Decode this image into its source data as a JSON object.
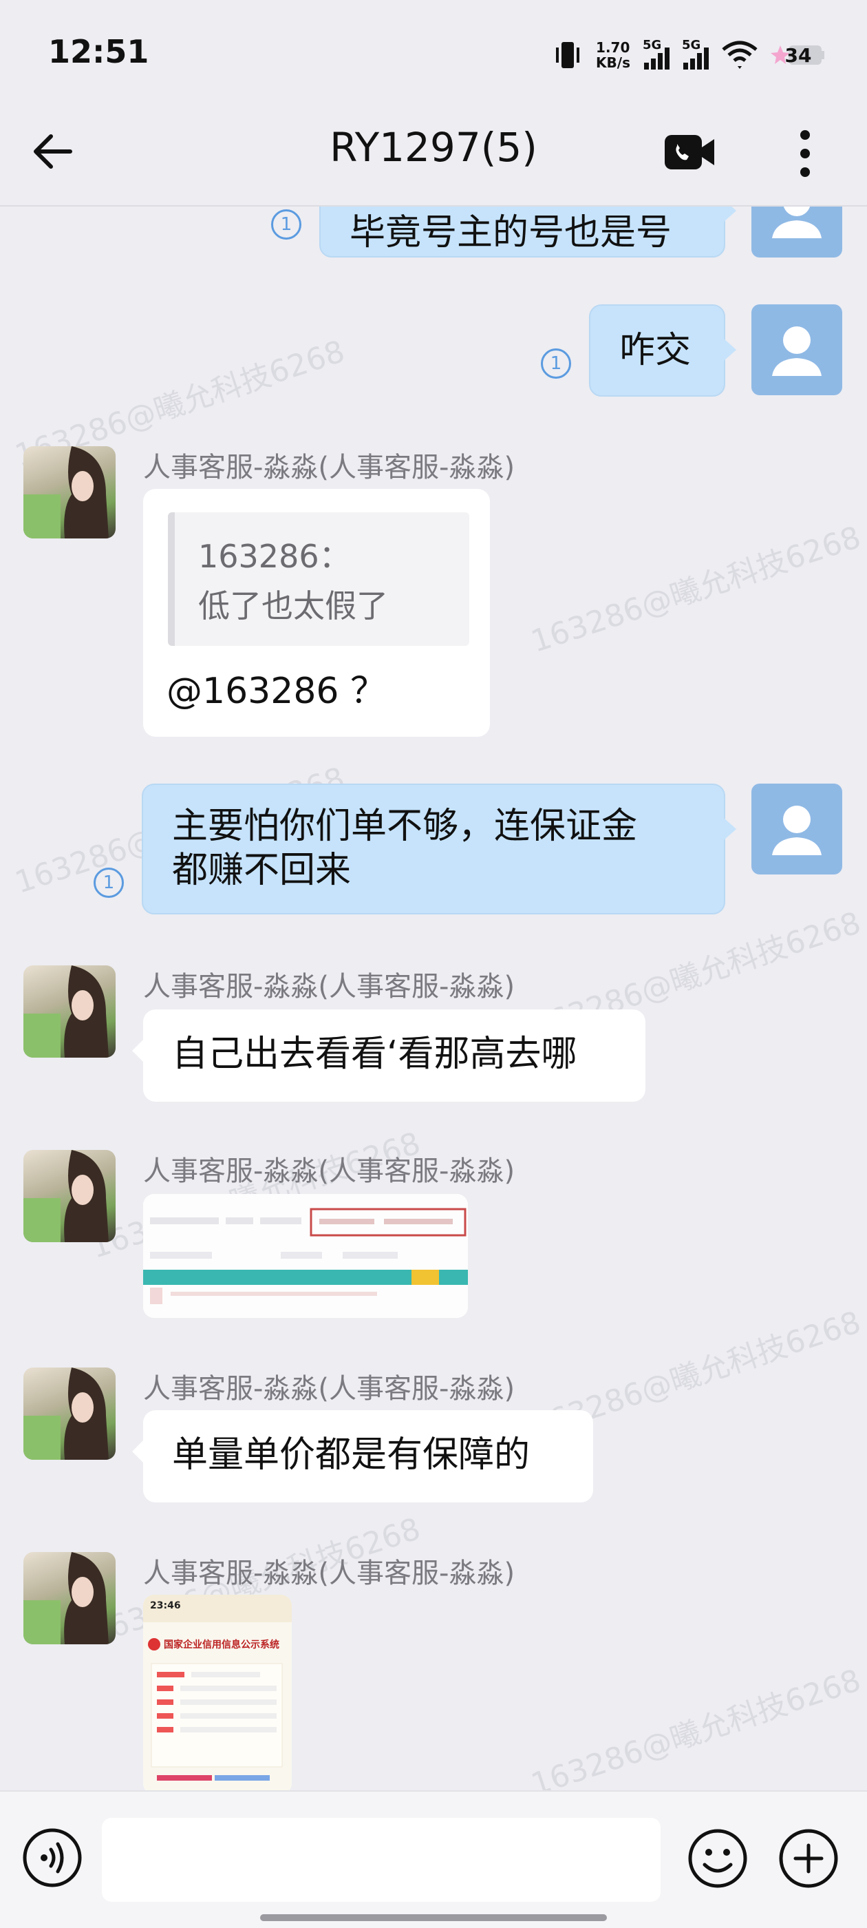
{
  "status_bar": {
    "time": "12:51",
    "net_speed_value": "1.70",
    "net_speed_unit": "KB/s",
    "signal1_label": "5G",
    "signal2_label": "5G",
    "battery_level": "34",
    "icons": [
      "vibrate-icon",
      "signal-icon",
      "wifi-icon",
      "battery-icon"
    ]
  },
  "header": {
    "title": "RY1297(5)",
    "icons": [
      "back-arrow-icon",
      "video-call-icon",
      "more-vert-icon"
    ]
  },
  "messages": {
    "m0_text": "毕竟号主的号也是号",
    "m0_read": "1",
    "m1_text": "咋交",
    "m1_read": "1",
    "m2_sender": "人事客服-淼淼(人事客服-淼淼)",
    "m2_quote_author": "163286：",
    "m2_quote_text": "低了也太假了",
    "m2_text": "@163286 ？",
    "m3_text_line1": "主要怕你们单不够，连保证金",
    "m3_text_line2": "都赚不回来",
    "m3_read": "1",
    "m4_sender": "人事客服-淼淼(人事客服-淼淼)",
    "m4_text": "自己出去看看‘看那高去哪",
    "m5_sender": "人事客服-淼淼(人事客服-淼淼)",
    "m6_sender": "人事客服-淼淼(人事客服-淼淼)",
    "m6_text": "单量单价都是有保障的",
    "m7_sender": "人事客服-淼淼(人事客服-淼淼)",
    "m7_image_time": "23:46",
    "m7_image_title": "国家企业信用信息公示系统"
  },
  "watermark_text": "163286@曦允科技6268",
  "input_bar": {
    "placeholder": "",
    "icons": [
      "voice-icon",
      "emoji-icon",
      "plus-icon"
    ]
  },
  "colors": {
    "background": "#ededf2",
    "self_bubble": "#c6e3fb",
    "other_bubble": "#ffffff",
    "read_mark": "#5b9be0",
    "sender_name": "#7a7a80"
  }
}
